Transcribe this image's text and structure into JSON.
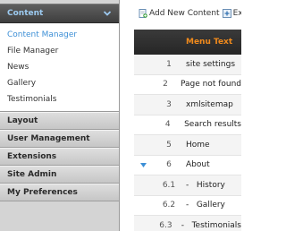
{
  "sidebar": {
    "active_section": {
      "label": "Content",
      "items": [
        {
          "label": "Content Manager",
          "active": true
        },
        {
          "label": "File Manager",
          "active": false
        },
        {
          "label": "News",
          "active": false
        },
        {
          "label": "Gallery",
          "active": false
        },
        {
          "label": "Testimonials",
          "active": false
        }
      ]
    },
    "sections": [
      {
        "label": "Layout"
      },
      {
        "label": "User Management"
      },
      {
        "label": "Extensions"
      },
      {
        "label": "Site Admin"
      },
      {
        "label": "My Preferences"
      }
    ]
  },
  "toolbar": {
    "add_label": "Add New Content",
    "expand_label": "Expa"
  },
  "table": {
    "header": "Menu Text",
    "rows": [
      {
        "num": "1",
        "text": "site settings",
        "expanded": false
      },
      {
        "num": "2",
        "text": "Page not found",
        "expanded": false
      },
      {
        "num": "3",
        "text": "xmlsitemap",
        "expanded": false
      },
      {
        "num": "4",
        "text": "Search results",
        "expanded": false
      },
      {
        "num": "5",
        "text": "Home",
        "expanded": false
      },
      {
        "num": "6",
        "text": "About",
        "expanded": true
      },
      {
        "num": "6.1",
        "text": "-   History",
        "expanded": false
      },
      {
        "num": "6.2",
        "text": "-   Gallery",
        "expanded": false
      },
      {
        "num": "6.3",
        "text": "-   Testimonials",
        "expanded": false
      }
    ]
  },
  "colors": {
    "active_link": "#3d8fd6",
    "header_text": "#f08a1c",
    "expand_arrow": "#3d8fd6"
  }
}
